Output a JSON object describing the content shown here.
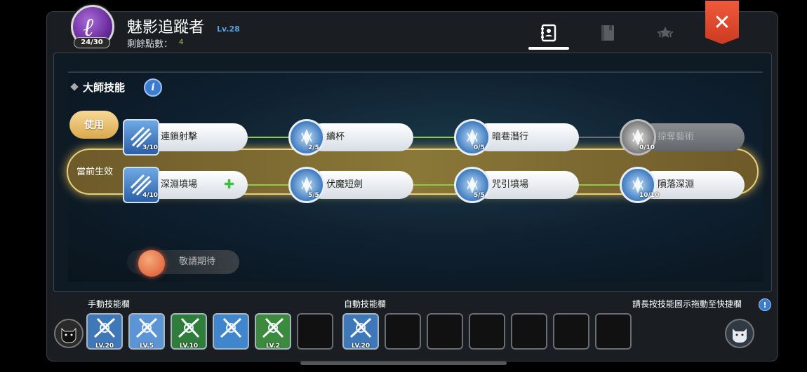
{
  "header": {
    "avatar_glyph": "ℓ",
    "avatar_progress": "24/30",
    "class_name": "魅影追蹤者",
    "level": "Lv.28",
    "points_label": "剩餘點數：",
    "points_value": "4"
  },
  "tabs": [
    {
      "name": "skills",
      "icon": "contact-book-icon",
      "active": true
    },
    {
      "name": "book",
      "icon": "book-icon",
      "active": false
    },
    {
      "name": "rank",
      "icon": "star-emblem-icon",
      "active": false
    }
  ],
  "close_symbol": "✕",
  "master": {
    "title": "大師技能",
    "info_symbol": "i",
    "use_label": "使用",
    "active_label": "當前生效",
    "coming_soon": "敬請期待",
    "rows": [
      [
        {
          "name": "連鎖射擊",
          "count": "3/10",
          "icon": "multi-arrow-icon",
          "style": "square",
          "disabled": false
        },
        {
          "name": "續杯",
          "count": "2/5",
          "icon": "blue-crystal-icon",
          "style": "round",
          "disabled": false
        },
        {
          "name": "暗巷潛行",
          "count": "0/5",
          "icon": "blue-crystal-icon",
          "style": "round",
          "disabled": false
        },
        {
          "name": "掠奪藝術",
          "count": "0/10",
          "icon": "grey-crystal-icon",
          "style": "round-grey",
          "disabled": true
        }
      ],
      [
        {
          "name": "深淵墳場",
          "count": "4/10",
          "icon": "grave-sack-icon",
          "style": "square",
          "disabled": false
        },
        {
          "name": "伏魔短劍",
          "count": "5/5",
          "icon": "blue-crystal-icon",
          "style": "round",
          "disabled": false
        },
        {
          "name": "咒引墳場",
          "count": "5/5",
          "icon": "blue-crystal-icon",
          "style": "round",
          "disabled": false
        },
        {
          "name": "隕落深淵",
          "count": "10/10",
          "icon": "blue-crystal-icon",
          "style": "round",
          "disabled": false
        }
      ]
    ]
  },
  "skill_bar": {
    "manual_label": "手動技能欄",
    "auto_label": "自動技能欄",
    "hint": "請長按技能圖示拖動至快捷欄",
    "hint_symbol": "!",
    "manual_slots": [
      {
        "icon": "crossed-arrows-icon",
        "level": "LV.20",
        "color": "#3f78b8"
      },
      {
        "icon": "down-arrow-strike-icon",
        "level": "LV.5",
        "color": "#5b95d6"
      },
      {
        "icon": "skull-target-icon",
        "level": "LV.10",
        "color": "#2f7d3a"
      },
      {
        "icon": "burst-arrows-icon",
        "level": "",
        "color": "#3f86cc"
      },
      {
        "icon": "twin-spirits-icon",
        "level": "LV.2",
        "color": "#3b8a3e"
      },
      {
        "icon": "",
        "level": "",
        "color": ""
      }
    ],
    "auto_slots": [
      {
        "icon": "crossed-arrows-icon",
        "level": "LV.20",
        "color": "#3f78b8"
      },
      {
        "icon": "",
        "level": "",
        "color": ""
      },
      {
        "icon": "",
        "level": "",
        "color": ""
      },
      {
        "icon": "",
        "level": "",
        "color": ""
      },
      {
        "icon": "",
        "level": "",
        "color": ""
      },
      {
        "icon": "",
        "level": "",
        "color": ""
      },
      {
        "icon": "",
        "level": "",
        "color": ""
      }
    ]
  }
}
